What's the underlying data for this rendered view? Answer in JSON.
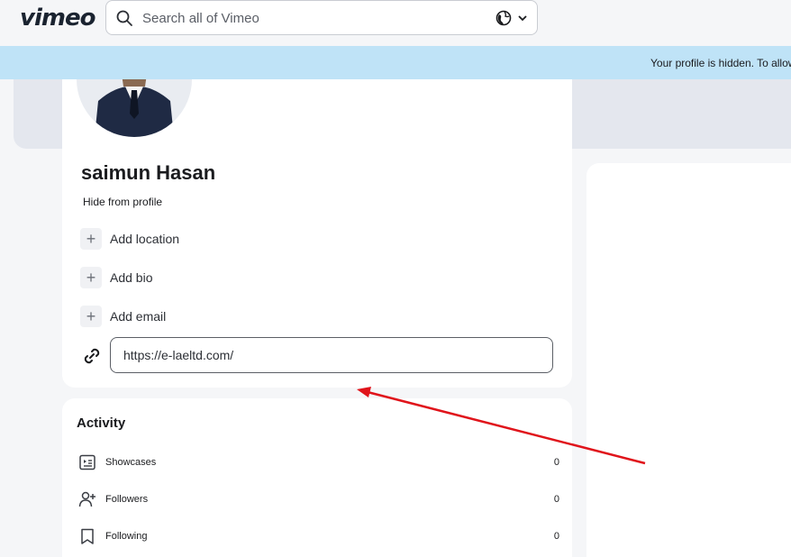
{
  "header": {
    "logo": "vimeo",
    "search_placeholder": "Search all of Vimeo",
    "search_icon": "search-icon",
    "language_icon": "globe-icon"
  },
  "banner": {
    "text": "Your profile is hidden. To allow"
  },
  "profile": {
    "name": "saimun Hasan",
    "hide_label": "Hide from profile",
    "add_items": [
      {
        "label": "Add location"
      },
      {
        "label": "Add bio"
      },
      {
        "label": "Add email"
      }
    ],
    "website_value": "https://e-laeltd.com/",
    "link_icon": "link-icon"
  },
  "activity": {
    "title": "Activity",
    "items": [
      {
        "label": "Showcases",
        "count": "0",
        "icon": "showcase-icon"
      },
      {
        "label": "Followers",
        "count": "0",
        "icon": "add-user-icon"
      },
      {
        "label": "Following",
        "count": "0",
        "icon": "bookmark-icon"
      }
    ]
  },
  "colors": {
    "banner": "#bfe3f7",
    "annotation_arrow": "#e0141b"
  }
}
